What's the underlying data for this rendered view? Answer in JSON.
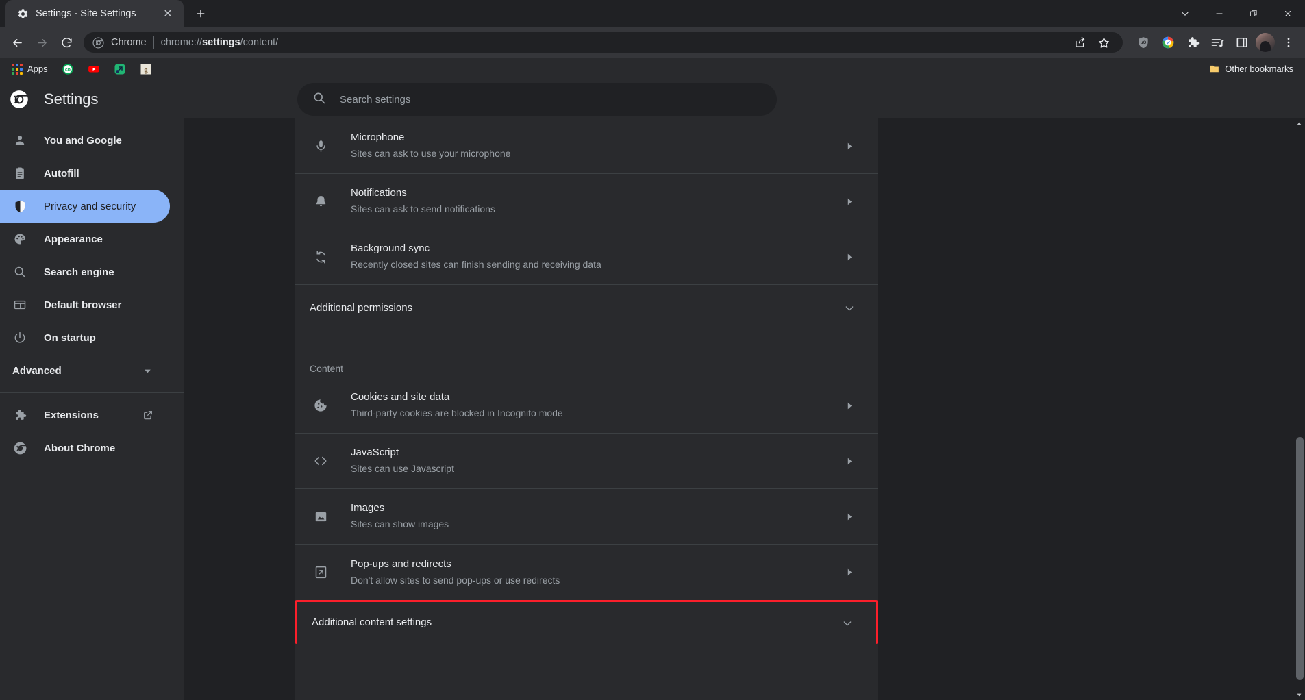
{
  "window": {
    "tab": {
      "title": "Settings - Site Settings",
      "favicon": "gear-icon",
      "close_label": "✕"
    },
    "new_tab_label": "+",
    "controls": {
      "minimize_to_tray_label": "⌄",
      "minimize_label": "—",
      "restore_label": "❐",
      "close_label": "✕"
    }
  },
  "toolbar": {
    "back_label": "←",
    "forward_label": "→",
    "reload_label": "↻",
    "omnibox": {
      "icon": "chrome-icon",
      "chip": "Chrome",
      "url_prefix": "chrome://",
      "url_bold": "settings",
      "url_suffix": "/content/"
    },
    "actions": {
      "share_label": "share-icon",
      "bookmark_label": "star-icon"
    },
    "extensions": [
      {
        "name": "ublock-origin-icon",
        "label": "uO"
      },
      {
        "name": "google-extension-icon",
        "label": ""
      },
      {
        "name": "puzzle-extensions-icon",
        "label": ""
      },
      {
        "name": "reading-list-icon",
        "label": ""
      },
      {
        "name": "side-panel-icon",
        "label": ""
      }
    ],
    "profile": "avatar",
    "menu_label": "⋮"
  },
  "bookmarks_bar": {
    "apps_label": "Apps",
    "items": [
      {
        "name": "bookmark-cb",
        "label": "cb"
      },
      {
        "name": "bookmark-youtube",
        "label": "▶"
      },
      {
        "name": "bookmark-green",
        "label": ""
      },
      {
        "name": "bookmark-goodreads",
        "label": "g"
      }
    ],
    "other_bookmarks_label": "Other bookmarks",
    "other_bookmarks_icon": "folder-icon"
  },
  "settings_header": {
    "logo": "chrome-logo-icon",
    "title": "Settings",
    "search": {
      "icon": "search-icon",
      "placeholder": "Search settings",
      "value": ""
    }
  },
  "sidebar": {
    "items": [
      {
        "label": "You and Google",
        "icon": "person-icon",
        "active": false
      },
      {
        "label": "Autofill",
        "icon": "clipboard-icon",
        "active": false
      },
      {
        "label": "Privacy and security",
        "icon": "shield-icon",
        "active": true
      },
      {
        "label": "Appearance",
        "icon": "palette-icon",
        "active": false
      },
      {
        "label": "Search engine",
        "icon": "search-icon",
        "active": false
      },
      {
        "label": "Default browser",
        "icon": "browser-window-icon",
        "active": false
      },
      {
        "label": "On startup",
        "icon": "power-icon",
        "active": false
      }
    ],
    "advanced": {
      "label": "Advanced",
      "caret": "chevron-down-icon"
    },
    "footer": [
      {
        "label": "Extensions",
        "icon": "puzzle-icon",
        "external": true
      },
      {
        "label": "About Chrome",
        "icon": "chrome-icon",
        "external": false
      }
    ]
  },
  "main": {
    "permissions_rows": [
      {
        "title": "Microphone",
        "subtitle": "Sites can ask to use your microphone",
        "icon": "microphone-icon",
        "arrow": "chevron-right-icon"
      },
      {
        "title": "Notifications",
        "subtitle": "Sites can ask to send notifications",
        "icon": "bell-icon",
        "arrow": "chevron-right-icon"
      },
      {
        "title": "Background sync",
        "subtitle": "Recently closed sites can finish sending and receiving data",
        "icon": "sync-icon",
        "arrow": "chevron-right-icon"
      }
    ],
    "additional_permissions": {
      "label": "Additional permissions",
      "caret": "chevron-down-icon"
    },
    "content_section_label": "Content",
    "content_rows": [
      {
        "title": "Cookies and site data",
        "subtitle": "Third-party cookies are blocked in Incognito mode",
        "icon": "cookie-icon",
        "arrow": "chevron-right-icon"
      },
      {
        "title": "JavaScript",
        "subtitle": "Sites can use Javascript",
        "icon": "code-brackets-icon",
        "arrow": "chevron-right-icon"
      },
      {
        "title": "Images",
        "subtitle": "Sites can show images",
        "icon": "image-icon",
        "arrow": "chevron-right-icon"
      },
      {
        "title": "Pop-ups and redirects",
        "subtitle": "Don't allow sites to send pop-ups or use redirects",
        "icon": "popup-icon",
        "arrow": "chevron-right-icon"
      }
    ],
    "additional_content_settings": {
      "label": "Additional content settings",
      "caret": "chevron-down-icon",
      "highlighted": true,
      "highlight_color": "#fb1f2b"
    }
  },
  "colors": {
    "accent": "#8ab4f8",
    "background": "#202124",
    "surface": "#292a2d",
    "toolbar": "#35363a",
    "divider": "#3c4043",
    "text_primary": "#e8eaed",
    "text_secondary": "#9aa0a6",
    "highlight": "#fb1f2b"
  }
}
